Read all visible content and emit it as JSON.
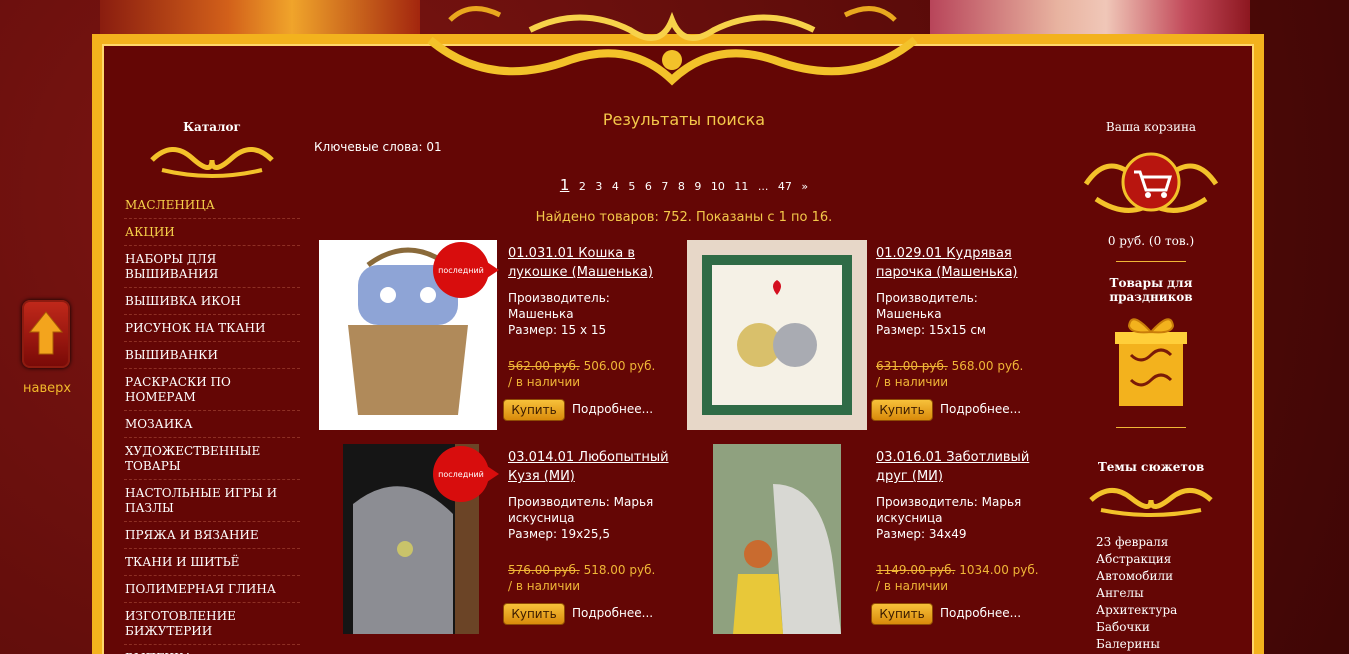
{
  "nav": {
    "scroll_top_label": "наверх"
  },
  "left": {
    "title": "Каталог",
    "categories": [
      "МАСЛЕНИЦА",
      "АКЦИИ",
      "НАБОРЫ ДЛЯ ВЫШИВАНИЯ",
      "ВЫШИВКА ИКОН",
      "РИСУНОК НА ТКАНИ",
      "ВЫШИВАНКИ",
      "РАСКРАСКИ ПО НОМЕРАМ",
      "МОЗАИКА",
      "ХУДОЖЕСТВЕННЫЕ ТОВАРЫ",
      "НАСТОЛЬНЫЕ ИГРЫ И ПАЗЛЫ",
      "ПРЯЖА И ВЯЗАНИЕ",
      "ТКАНИ И ШИТЬЁ",
      "ПОЛИМЕРНАЯ ГЛИНА",
      "ИЗГОТОВЛЕНИЕ БИЖУТЕРИИ",
      "ВЫПЕЧКА"
    ]
  },
  "main": {
    "title": "Результаты поиска",
    "keywords": "Ключевые слова: 01",
    "pager": [
      "1",
      "2",
      "3",
      "4",
      "5",
      "6",
      "7",
      "8",
      "9",
      "10",
      "11",
      "...",
      "47",
      "»"
    ],
    "found": "Найдено товаров: 752. Показаны с 1 по 16.",
    "badge_label": "последний",
    "products": [
      {
        "title": "01.031.01 Кошка в лукошке (Машенька)",
        "maker": "Производитель: Машенька",
        "size": "Размер: 15 х 15",
        "old_price": "562.00 руб.",
        "price": "506.00 руб.",
        "stock": "/ в наличии",
        "buy": "Купить",
        "more": "Подробнее..."
      },
      {
        "title": "01.029.01 Кудрявая парочка (Машенька)",
        "maker": "Производитель: Машенька",
        "size": "Размер: 15х15 см",
        "old_price": "631.00 руб.",
        "price": "568.00 руб.",
        "stock": "/ в наличии",
        "buy": "Купить",
        "more": "Подробнее..."
      },
      {
        "title": "03.014.01 Любопытный Кузя (МИ)",
        "maker": "Производитель: Марья искусница",
        "size": "Размер: 19х25,5",
        "old_price": "576.00 руб.",
        "price": "518.00 руб.",
        "stock": "/ в наличии",
        "buy": "Купить",
        "more": "Подробнее..."
      },
      {
        "title": "03.016.01 Заботливый друг (МИ)",
        "maker": "Производитель: Марья искусница",
        "size": "Размер: 34х49",
        "old_price": "1149.00 руб.",
        "price": "1034.00 руб.",
        "stock": "/ в наличии",
        "buy": "Купить",
        "more": "Подробнее..."
      }
    ]
  },
  "right": {
    "cart_title": "Ваша корзина",
    "cart_sum": "0 руб.   (0 тов.)",
    "holiday_title": "Товары для праздников",
    "themes_title": "Темы сюжетов",
    "themes": [
      "23 февраля",
      "Абстракция",
      "Автомобили",
      "Ангелы",
      "Архитектура",
      "Бабочки",
      "Балерины"
    ]
  },
  "colors": {
    "accent": "#f3b21d",
    "background": "#640605",
    "price": "#f0b637"
  }
}
